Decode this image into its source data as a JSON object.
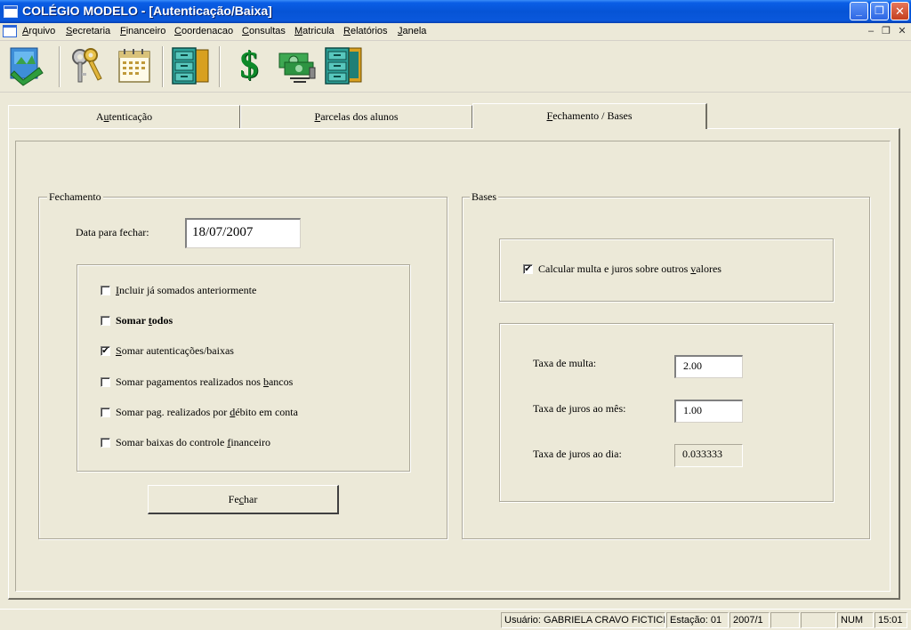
{
  "window": {
    "title": "COLÉGIO MODELO - [Autenticação/Baixa]",
    "minimize_glyph": "_",
    "maximize_glyph": "❐",
    "close_glyph": "✕"
  },
  "menu": {
    "items": [
      {
        "label": "Arquivo",
        "accel": "A",
        "rest": "rquivo"
      },
      {
        "label": "Secretaria",
        "accel": "S",
        "rest": "ecretaria"
      },
      {
        "label": "Financeiro",
        "accel": "F",
        "rest": "inanceiro"
      },
      {
        "label": "Coordenacao",
        "accel": "C",
        "rest": "oordenacao"
      },
      {
        "label": "Consultas",
        "accel": "C",
        "rest": "onsultas"
      },
      {
        "label": "Matricula",
        "accel": "M",
        "rest": "atricula"
      },
      {
        "label": "Relatórios",
        "accel": "R",
        "rest": "elatórios"
      },
      {
        "label": "Janela",
        "accel": "J",
        "rest": "anela"
      }
    ],
    "mdi_minimize": "–",
    "mdi_restore": "❐",
    "mdi_close": "✕"
  },
  "toolbar": {
    "icons": [
      "map-icon",
      "keys-icon",
      "calendar-icon",
      "file-cabinet-icon",
      "dollar-icon",
      "money-transfer-icon",
      "file-cabinet-open-icon"
    ],
    "dollar_glyph": "$"
  },
  "tabs": [
    {
      "pre": "A",
      "accel": "u",
      "post": "tenticação",
      "active": false
    },
    {
      "pre": "",
      "accel": "P",
      "post": "arcelas dos alunos",
      "active": false
    },
    {
      "pre": "",
      "accel": "F",
      "post": "echamento / Bases",
      "active": true
    }
  ],
  "fechamento": {
    "group_label": "Fechamento",
    "date_label": "Data para fechar:",
    "date_value": "18/07/2007",
    "checkboxes": [
      {
        "pre": "",
        "accel": "I",
        "post": "ncluir já somados anteriormente",
        "checked": false,
        "bold": false
      },
      {
        "pre": "Somar ",
        "accel": "t",
        "post": "odos",
        "checked": false,
        "bold": true
      },
      {
        "pre": "",
        "accel": "S",
        "post": "omar autenticações/baixas",
        "checked": true,
        "bold": false
      },
      {
        "pre": "Somar pagamentos realizados nos ",
        "accel": "b",
        "post": "ancos",
        "checked": false,
        "bold": false
      },
      {
        "pre": "Somar pag. realizados por ",
        "accel": "d",
        "post": "ébito em conta",
        "checked": false,
        "bold": false
      },
      {
        "pre": "Somar baixas do controle ",
        "accel": "f",
        "post": "inanceiro",
        "checked": false,
        "bold": false
      }
    ],
    "check_glyph": "✔",
    "button": {
      "pre": "Fe",
      "accel": "c",
      "post": "har"
    }
  },
  "bases": {
    "group_label": "Bases",
    "calc_checkbox": {
      "pre": "Calcular multa e juros sobre outros ",
      "accel": "v",
      "post": "alores",
      "checked": true
    },
    "fields": [
      {
        "label": "Taxa de multa:",
        "value": "2.00",
        "readonly": false
      },
      {
        "label": "Taxa de juros ao mês:",
        "value": "1.00",
        "readonly": false
      },
      {
        "label": "Taxa de juros ao dia:",
        "value": "0.033333",
        "readonly": true
      }
    ]
  },
  "status": {
    "user": "Usuário: GABRIELA CRAVO FICTICIO",
    "station": "Estação: 01",
    "period": "2007/1",
    "empty1": "",
    "empty2": "",
    "num": "NUM",
    "time": "15:01"
  },
  "colors": {
    "titlebar": "#0654d6",
    "face": "#ece9d8",
    "shadow": "#aca899"
  }
}
